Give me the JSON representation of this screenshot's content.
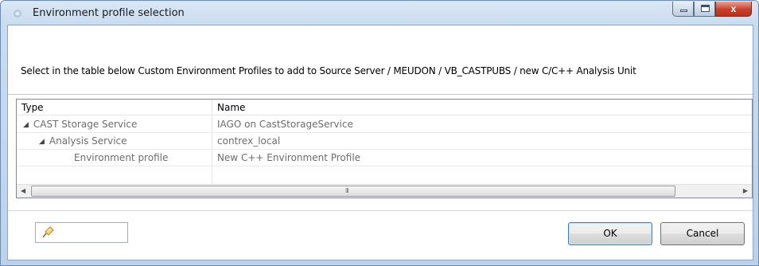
{
  "window": {
    "title": "Environment profile selection",
    "close_glyph": "x"
  },
  "instruction": "Select in the table below Custom Environment Profiles to add to Source Server / MEUDON / VB_CASTPUBS / new C/C++ Analysis Unit",
  "table": {
    "columns": [
      "Type",
      "Name"
    ],
    "rows": [
      {
        "type": "CAST Storage Service",
        "name": "IAGO on CastStorageService",
        "level": 0,
        "expanded": true
      },
      {
        "type": "Analysis Service",
        "name": "contrex_local",
        "level": 1,
        "expanded": true
      },
      {
        "type": "Environment profile",
        "name": "New C++ Environment Profile",
        "level": 2,
        "expanded": false
      }
    ],
    "scroll_grip": "III"
  },
  "buttons": {
    "ok": "OK",
    "cancel": "Cancel"
  },
  "icons": {
    "title": "app-icon",
    "field": "pin-icon",
    "tree_toggle": "expanded-triangle-icon"
  }
}
